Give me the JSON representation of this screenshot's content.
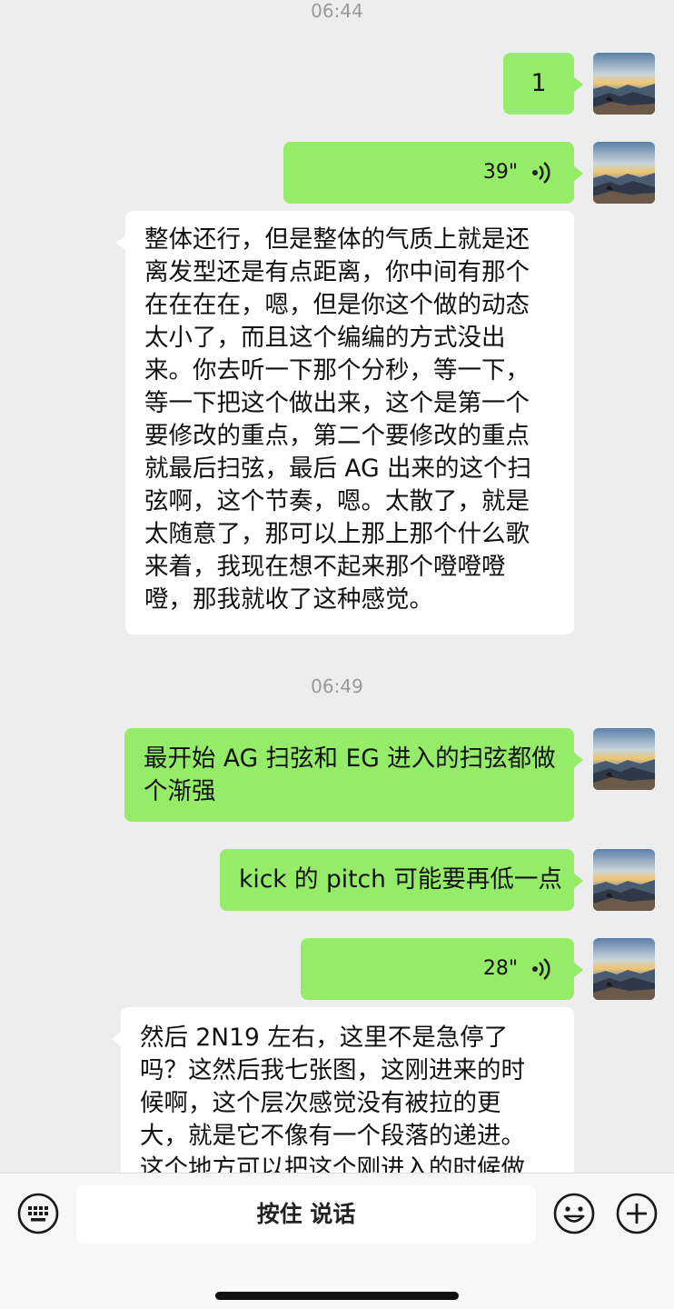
{
  "colors": {
    "background": "#ededed",
    "my_bubble": "#95ec69",
    "their_bubble": "#ffffff",
    "input_bar": "#f7f7f7"
  },
  "messages": [
    {
      "type": "time",
      "text": "06:44"
    },
    {
      "type": "text",
      "from": "me",
      "text": "1",
      "avatar": "landscape-avatar"
    },
    {
      "type": "voice",
      "from": "me",
      "duration": "39\"",
      "avatar": "landscape-avatar"
    },
    {
      "type": "text",
      "from": "them",
      "lines": [
        "整体还行，但是整体的气质上就是还",
        "离发型还是有点距离，你中间有那个",
        "在在在在，嗯，但是你这个做的动态",
        "太小了，而且这个编编的方式没出",
        "来。你去听一下那个分秒，等一下，",
        "等一下把这个做出来，这个是第一个",
        "要修改的重点，第二个要修改的重点",
        "就最后扫弦，最后 AG 出来的这个扫",
        "弦啊，这个节奏，嗯。太散了，就是",
        "太随意了，那可以上那上那个什么歌",
        "来着，我现在想不起来那个噔噔噔",
        "噔，那我就收了这种感觉。"
      ]
    },
    {
      "type": "time",
      "text": "06:49"
    },
    {
      "type": "text",
      "from": "me",
      "lines": [
        "最开始 AG 扫弦和 EG 进入的扫弦都做",
        "个渐强"
      ],
      "avatar": "landscape-avatar"
    },
    {
      "type": "text",
      "from": "me",
      "text": "kick 的 pitch 可能要再低一点",
      "avatar": "landscape-avatar"
    },
    {
      "type": "voice",
      "from": "me",
      "duration": "28\"",
      "avatar": "landscape-avatar"
    },
    {
      "type": "text",
      "from": "them",
      "lines": [
        "然后 2N19 左右，这里不是急停了",
        "吗？这然后我七张图，这刚进来的时",
        "候啊，这个层次感觉没有被拉的更",
        "大，就是它不像有一个段落的递进。",
        "这个地方可以把这个刚进入的时候做"
      ]
    }
  ],
  "input_bar": {
    "talk_label": "按住 说话",
    "left_icon": "keyboard-icon",
    "right_icons": [
      "emoji-icon",
      "plus-icon"
    ]
  }
}
